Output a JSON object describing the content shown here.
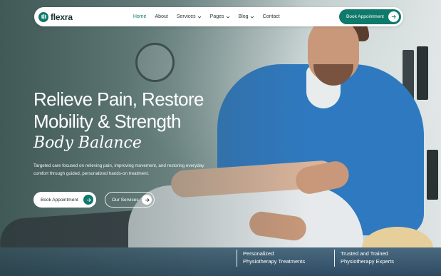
{
  "nav": {
    "logo_text": "flexra",
    "items": [
      {
        "label": "Home",
        "active": true,
        "dropdown": false
      },
      {
        "label": "About",
        "active": false,
        "dropdown": false
      },
      {
        "label": "Services",
        "active": false,
        "dropdown": true
      },
      {
        "label": "Pages",
        "active": false,
        "dropdown": true
      },
      {
        "label": "Blog",
        "active": false,
        "dropdown": true
      },
      {
        "label": "Contact",
        "active": false,
        "dropdown": false
      }
    ],
    "cta_label": "Book Appointment"
  },
  "hero": {
    "title_line1": "Relieve Pain, Restore",
    "title_line2": "Mobility & Strength",
    "subtitle": "Body Balance",
    "description": "Targeted care focused on relieving pain, improving movement, and restoring everyday comfort through guided, personalized hands-on treatment.",
    "primary_button": "Book Appointment",
    "secondary_button": "Our Services"
  },
  "features": [
    {
      "line1": "Personalized",
      "line2": "Physiotherapy Treatments"
    },
    {
      "line1": "Trusted and Trained",
      "line2": "Physiotherapy Experts"
    }
  ],
  "colors": {
    "accent": "#0f7a6b",
    "nav_background": "#ffffff",
    "hero_text": "#ffffff"
  },
  "icons": {
    "logo": "leaf-logo-icon",
    "dropdown": "chevron-down-icon",
    "button_arrow": "arrow-right-icon"
  }
}
